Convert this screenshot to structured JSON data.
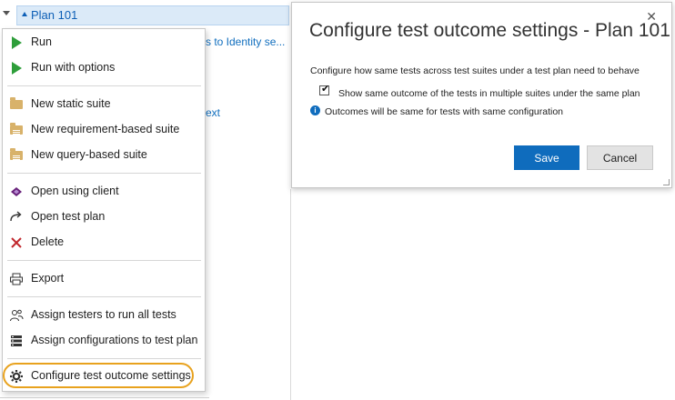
{
  "tree": {
    "plan_label": "Plan 101",
    "bg_link_1": "s to Identity se...",
    "bg_link_2": "ext"
  },
  "menu": {
    "groups": [
      [
        {
          "label": "Run",
          "icon": "play-icon"
        },
        {
          "label": "Run with options",
          "icon": "play-icon"
        }
      ],
      [
        {
          "label": "New static suite",
          "icon": "folder-icon"
        },
        {
          "label": "New requirement-based suite",
          "icon": "requirement-folder-icon"
        },
        {
          "label": "New query-based suite",
          "icon": "query-folder-icon"
        }
      ],
      [
        {
          "label": "Open using client",
          "icon": "client-icon"
        },
        {
          "label": "Open test plan",
          "icon": "open-arrow-icon"
        },
        {
          "label": "Delete",
          "icon": "delete-x-icon"
        }
      ],
      [
        {
          "label": "Export",
          "icon": "printer-icon"
        }
      ],
      [
        {
          "label": "Assign testers to run all tests",
          "icon": "testers-icon"
        },
        {
          "label": "Assign configurations to test plan",
          "icon": "configurations-icon"
        }
      ],
      [
        {
          "label": "Configure test outcome settings",
          "icon": "gear-icon"
        }
      ]
    ],
    "highlight_color": "#e8a21e"
  },
  "dialog": {
    "title": "Configure test outcome settings - Plan 101",
    "description": "Configure how same tests across test suites under a test plan need to behave",
    "checkbox_label": "Show same outcome of the tests in multiple suites under the same plan",
    "checkbox_checked": true,
    "info_text": "Outcomes will be same for tests with same configuration",
    "save_label": "Save",
    "cancel_label": "Cancel",
    "close_glyph": "✕",
    "accent": "#0f6cbd"
  }
}
